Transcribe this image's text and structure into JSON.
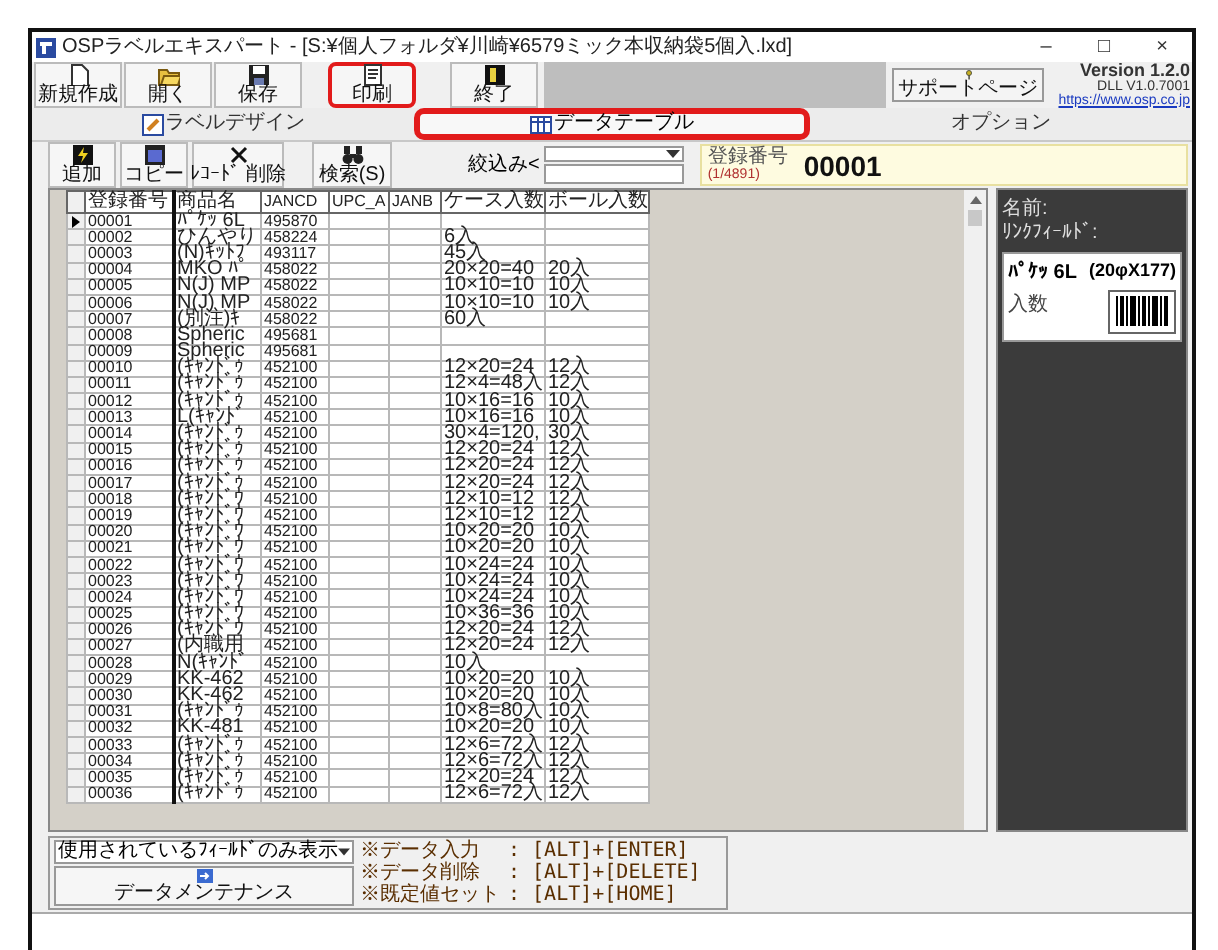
{
  "window": {
    "title": "OSPラベルエキスパート - [S:¥個人フォルダ¥川崎¥6579ミック本収納袋5個入.lxd]",
    "controls": [
      "–",
      "□",
      "×"
    ]
  },
  "toolbar": {
    "buttons": [
      {
        "label": "新規作成",
        "kind": "new",
        "highlighted": false
      },
      {
        "label": "開く",
        "kind": "open",
        "highlighted": false
      },
      {
        "label": "保存",
        "kind": "save",
        "highlighted": false
      },
      {
        "label": "印刷",
        "kind": "print",
        "highlighted": true
      },
      {
        "label": "終了",
        "kind": "exit",
        "highlighted": false
      }
    ],
    "support_button": "サポートページ",
    "version": "Version 1.2.0",
    "dll": "DLL V1.0.7001",
    "link": "https://www.osp.co.jp"
  },
  "tabs": [
    {
      "label": "ラベルデザイン",
      "kind": "design",
      "selected": false,
      "highlighted": false
    },
    {
      "label": "データテーブル",
      "kind": "table",
      "selected": true,
      "highlighted": true
    },
    {
      "label": "オプション",
      "kind": "plain",
      "selected": false,
      "highlighted": false
    }
  ],
  "records": {
    "buttons": [
      {
        "label": "追加",
        "kind": "add"
      },
      {
        "label": "コピー",
        "kind": "copy"
      },
      {
        "label": "ﾚｺｰﾄﾞ 削除",
        "kind": "delete"
      },
      {
        "label": "検索(S)",
        "kind": "search"
      }
    ],
    "filter_label": "絞込み<",
    "current_label": "登録番号",
    "position": "(1/4891)",
    "current_value": "00001"
  },
  "table": {
    "columns": [
      "登録番号",
      "商品名",
      "JANCD",
      "UPC_A",
      "JANB",
      "ケース入数",
      "ボール入数"
    ],
    "rows": [
      {
        "selected": true,
        "number": "00001",
        "product": "ﾊﾟｹｯ 6L",
        "jancd": "495870"
      },
      {
        "selected": false,
        "number": "00002",
        "product": "ひんやり",
        "jancd": "458224",
        "case_qty": "6入"
      },
      {
        "selected": false,
        "number": "00003",
        "product": "(N)ｷｯﾄﾌ",
        "jancd": "493117",
        "case_qty": "45入"
      },
      {
        "selected": false,
        "number": "00004",
        "product": "MKO ﾊﾟ",
        "jancd": "458022",
        "case_qty": "20×20=40",
        "ball_qty": "20入"
      },
      {
        "selected": false,
        "number": "00005",
        "product": "N(J) MP",
        "jancd": "458022",
        "case_qty": "10×10=10",
        "ball_qty": "10入"
      },
      {
        "selected": false,
        "number": "00006",
        "product": "N(J) MP",
        "jancd": "458022",
        "case_qty": "10×10=10",
        "ball_qty": "10入"
      },
      {
        "selected": false,
        "number": "00007",
        "product": "(別注)ｷ",
        "jancd": "458022",
        "case_qty": "60入"
      },
      {
        "selected": false,
        "number": "00008",
        "product": "Spheric",
        "jancd": "495681"
      },
      {
        "selected": false,
        "number": "00009",
        "product": "Spheric",
        "jancd": "495681"
      },
      {
        "selected": false,
        "number": "00010",
        "product": "(ｷｬﾝﾄﾞｩ",
        "jancd": "452100",
        "case_qty": "12×20=24",
        "ball_qty": "12入"
      },
      {
        "selected": false,
        "number": "00011",
        "product": "(ｷｬﾝﾄﾞｩ",
        "jancd": "452100",
        "case_qty": "12×4=48入",
        "ball_qty": "12入"
      },
      {
        "selected": false,
        "number": "00012",
        "product": "(ｷｬﾝﾄﾞｩ",
        "jancd": "452100",
        "case_qty": "10×16=16",
        "ball_qty": "10入"
      },
      {
        "selected": false,
        "number": "00013",
        "product": "L(ｷｬﾝﾄﾞ",
        "jancd": "452100",
        "case_qty": "10×16=16",
        "ball_qty": "10入"
      },
      {
        "selected": false,
        "number": "00014",
        "product": "(ｷｬﾝﾄﾞｩ",
        "jancd": "452100",
        "case_qty": "30×4=120,",
        "ball_qty": "30入"
      },
      {
        "selected": false,
        "number": "00015",
        "product": "(ｷｬﾝﾄﾞｩ",
        "jancd": "452100",
        "case_qty": "12×20=24",
        "ball_qty": "12入"
      },
      {
        "selected": false,
        "number": "00016",
        "product": "(ｷｬﾝﾄﾞｩ",
        "jancd": "452100",
        "case_qty": "12×20=24",
        "ball_qty": "12入"
      },
      {
        "selected": false,
        "number": "00017",
        "product": "(ｷｬﾝﾄﾞｩ",
        "jancd": "452100",
        "case_qty": "12×20=24",
        "ball_qty": "12入"
      },
      {
        "selected": false,
        "number": "00018",
        "product": "(ｷｬﾝﾄﾞｳ",
        "jancd": "452100",
        "case_qty": "12×10=12",
        "ball_qty": "12入"
      },
      {
        "selected": false,
        "number": "00019",
        "product": "(ｷｬﾝﾄﾞｳ",
        "jancd": "452100",
        "case_qty": "12×10=12",
        "ball_qty": "12入"
      },
      {
        "selected": false,
        "number": "00020",
        "product": "(ｷｬﾝﾄﾞｳ",
        "jancd": "452100",
        "case_qty": "10×20=20",
        "ball_qty": "10入"
      },
      {
        "selected": false,
        "number": "00021",
        "product": "(ｷｬﾝﾄﾞｳ",
        "jancd": "452100",
        "case_qty": "10×20=20",
        "ball_qty": "10入"
      },
      {
        "selected": false,
        "number": "00022",
        "product": "(ｷｬﾝﾄﾞｳ",
        "jancd": "452100",
        "case_qty": "10×24=24",
        "ball_qty": "10入"
      },
      {
        "selected": false,
        "number": "00023",
        "product": "(ｷｬﾝﾄﾞｳ",
        "jancd": "452100",
        "case_qty": "10×24=24",
        "ball_qty": "10入"
      },
      {
        "selected": false,
        "number": "00024",
        "product": "(ｷｬﾝﾄﾞｳ",
        "jancd": "452100",
        "case_qty": "10×24=24",
        "ball_qty": "10入"
      },
      {
        "selected": false,
        "number": "00025",
        "product": "(ｷｬﾝﾄﾞｳ",
        "jancd": "452100",
        "case_qty": "10×36=36",
        "ball_qty": "10入"
      },
      {
        "selected": false,
        "number": "00026",
        "product": "(ｷｬﾝﾄﾞｳ",
        "jancd": "452100",
        "case_qty": "12×20=24",
        "ball_qty": "12入"
      },
      {
        "selected": false,
        "number": "00027",
        "product": "(内職用",
        "jancd": "452100",
        "case_qty": "12×20=24",
        "ball_qty": "12入"
      },
      {
        "selected": false,
        "number": "00028",
        "product": "N(ｷｬﾝﾄﾞ",
        "jancd": "452100",
        "case_qty": "10入"
      },
      {
        "selected": false,
        "number": "00029",
        "product": "KK-462",
        "jancd": "452100",
        "case_qty": "10×20=20",
        "ball_qty": "10入"
      },
      {
        "selected": false,
        "number": "00030",
        "product": "KK-462",
        "jancd": "452100",
        "case_qty": "10×20=20",
        "ball_qty": "10入"
      },
      {
        "selected": false,
        "number": "00031",
        "product": "(ｷｬﾝﾄﾞｩ",
        "jancd": "452100",
        "case_qty": "10×8=80入",
        "ball_qty": "10入"
      },
      {
        "selected": false,
        "number": "00032",
        "product": "KK-481",
        "jancd": "452100",
        "case_qty": "10×20=20",
        "ball_qty": "10入"
      },
      {
        "selected": false,
        "number": "00033",
        "product": "(ｷｬﾝﾄﾞｩ",
        "jancd": "452100",
        "case_qty": "12×6=72入",
        "ball_qty": "12入"
      },
      {
        "selected": false,
        "number": "00034",
        "product": "(ｷｬﾝﾄﾞｩ",
        "jancd": "452100",
        "case_qty": "12×6=72入",
        "ball_qty": "12入"
      },
      {
        "selected": false,
        "number": "00035",
        "product": "(ｷｬﾝﾄﾞｩ",
        "jancd": "452100",
        "case_qty": "12×20=24",
        "ball_qty": "12入"
      },
      {
        "selected": false,
        "number": "00036",
        "product": "(ｷｬﾝﾄﾞｩ",
        "jancd": "452100",
        "case_qty": "12×6=72入",
        "ball_qty": "12入"
      }
    ]
  },
  "preview": {
    "name_label": "名前:",
    "link_label": "ﾘﾝｸﾌｨｰﾙﾄﾞ:",
    "title": "ﾊﾟｹｯ 6L",
    "size": "(20φX177)",
    "qty_label": "入数"
  },
  "footer": {
    "field_filter": "使用されているﾌｨｰﾙﾄﾞのみ表示",
    "maintenance_button": "データメンテナンス",
    "shortcuts": [
      {
        "action": "※データ入力",
        "keys": ": [ALT]+[ENTER]"
      },
      {
        "action": "※データ削除",
        "keys": ": [ALT]+[DELETE]"
      },
      {
        "action": "※既定値セット",
        "keys": ": [ALT]+[HOME]"
      }
    ]
  }
}
